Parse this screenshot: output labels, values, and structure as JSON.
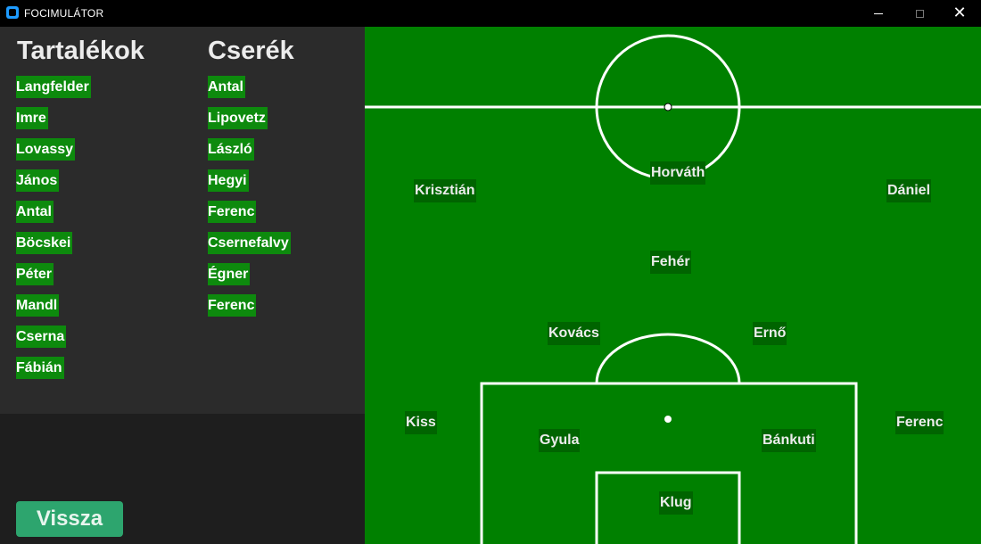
{
  "window": {
    "title": "FOCIMULÁTOR",
    "icon": "app-icon",
    "controls": {
      "minimize": "minimize-icon",
      "maximize": "maximize-icon",
      "close": "close-icon"
    }
  },
  "sidebar": {
    "reserves_title": "Tartalékok",
    "subs_title": "Cserék",
    "reserves": [
      "Langfelder",
      "Imre",
      "Lovassy",
      "János",
      "Antal",
      "Böcskei",
      "Péter",
      "Mandl",
      "Cserna",
      "Fábián"
    ],
    "substitutes": [
      "Antal",
      "Lipovetz",
      "László",
      "Hegyi",
      "Ferenc",
      "Csernefalvy",
      "Égner",
      "Ferenc"
    ],
    "back_label": "Vissza"
  },
  "pitch": {
    "players": [
      "Horváth",
      "Krisztián",
      "Dániel",
      "Fehér",
      "Kovács",
      "Ernő",
      "Kiss",
      "Gyula",
      "Bánkuti",
      "Ferenc",
      "Klug"
    ]
  },
  "colors": {
    "pitch": "#008000",
    "position_chip": "#006400",
    "list_chip": "#0d8a0d",
    "back_button": "#2da56e",
    "panel": "#2b2b2b",
    "titlebar": "#000000"
  }
}
